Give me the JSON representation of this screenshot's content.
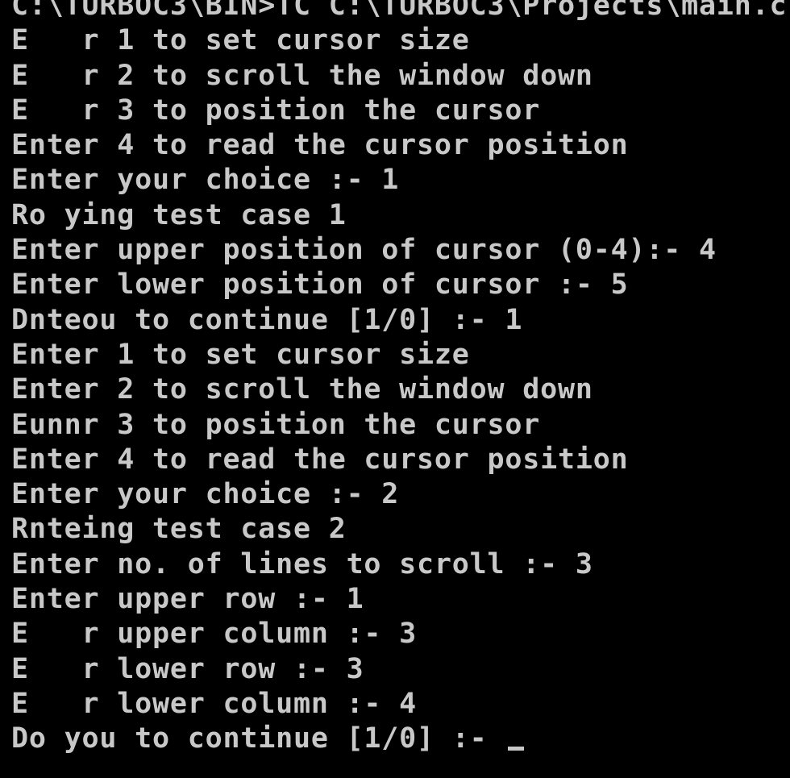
{
  "terminal": {
    "header": "C:\\TURBOC3\\BIN>TC C:\\TURBOC3\\Projects\\main.c",
    "lines": [
      "E   r 1 to set cursor size",
      "E   r 2 to scroll the window down",
      "E   r 3 to position the cursor",
      "Enter 4 to read the cursor position",
      "Enter your choice :- 1",
      "Ro ying test case 1",
      "Enter upper position of cursor (0-4):- 4",
      "Enter lower position of cursor :- 5",
      "Dnteou to continue [1/0] :- 1",
      "Enter 1 to set cursor size",
      "Enter 2 to scroll the window down",
      "Eunnr 3 to position the cursor",
      "Enter 4 to read the cursor position",
      "Enter your choice :- 2",
      "Rnteing test case 2",
      "Enter no. of lines to scroll :- 3",
      "Enter upper row :- 1",
      "E   r upper column :- 3",
      "E   r lower row :- 3",
      "E   r lower column :- 4"
    ],
    "prompt": "Do you to continue [1/0] :- "
  },
  "colors": {
    "background": "#000000",
    "foreground": "#c8c8c8"
  }
}
